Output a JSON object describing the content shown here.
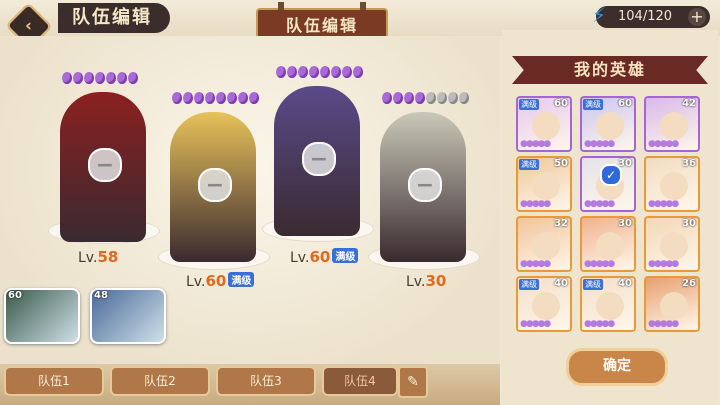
{
  "header": {
    "back_icon": "back-arrow-icon",
    "title": "队伍编辑",
    "center_plaque": "队伍编辑",
    "energy": {
      "value": "104/120",
      "icon": "lightning-icon",
      "plus": "+"
    }
  },
  "stage": {
    "slots": [
      {
        "level_prefix": "Lv.",
        "level": "58",
        "badge": "",
        "pips": 7,
        "gray_pips": 0,
        "color": "#8b2020"
      },
      {
        "level_prefix": "Lv.",
        "level": "60",
        "badge": "满级",
        "pips": 8,
        "gray_pips": 0,
        "color": "#e8c25a"
      },
      {
        "level_prefix": "Lv.",
        "level": "60",
        "badge": "满级",
        "pips": 8,
        "gray_pips": 0,
        "color": "#5a4a8a"
      },
      {
        "level_prefix": "Lv.",
        "level": "30",
        "badge": "",
        "pips": 4,
        "gray_pips": 4,
        "color": "#c9c9b8"
      }
    ],
    "reserve": [
      {
        "level": "60",
        "color": "#3a5a4a"
      },
      {
        "level": "48",
        "color": "#4a6a9a"
      }
    ]
  },
  "panel": {
    "title": "我的英雄",
    "cards": [
      {
        "level": "60",
        "max": "满级",
        "border": "#a565d8",
        "bg": "#e6c8ef",
        "checked": false
      },
      {
        "level": "60",
        "max": "满级",
        "border": "#a565d8",
        "bg": "#c9c6ef",
        "checked": false
      },
      {
        "level": "42",
        "max": "",
        "border": "#a565d8",
        "bg": "#d8b9e8",
        "checked": false
      },
      {
        "level": "50",
        "max": "满级",
        "border": "#e89a3a",
        "bg": "#f0c79a",
        "checked": false
      },
      {
        "level": "30",
        "max": "",
        "border": "#a565d8",
        "bg": "#e3e3ea",
        "checked": true
      },
      {
        "level": "36",
        "max": "",
        "border": "#e89a3a",
        "bg": "#f2dcc0",
        "checked": false
      },
      {
        "level": "32",
        "max": "",
        "border": "#e89a3a",
        "bg": "#f1c49a",
        "checked": false
      },
      {
        "level": "30",
        "max": "",
        "border": "#e89a3a",
        "bg": "#f0b28e",
        "checked": false
      },
      {
        "level": "30",
        "max": "",
        "border": "#e89a3a",
        "bg": "#f2d7b5",
        "checked": false
      },
      {
        "level": "40",
        "max": "满级",
        "border": "#e89a3a",
        "bg": "#f4dfc8",
        "checked": false
      },
      {
        "level": "40",
        "max": "满级",
        "border": "#e89a3a",
        "bg": "#f4dfc8",
        "checked": false
      },
      {
        "level": "26",
        "max": "",
        "border": "#e89a3a",
        "bg": "#e8a070",
        "checked": false
      }
    ],
    "confirm": "确定"
  },
  "tabs": [
    "队伍1",
    "队伍2",
    "队伍3",
    "队伍4"
  ],
  "edit_icon": "pencil-icon"
}
